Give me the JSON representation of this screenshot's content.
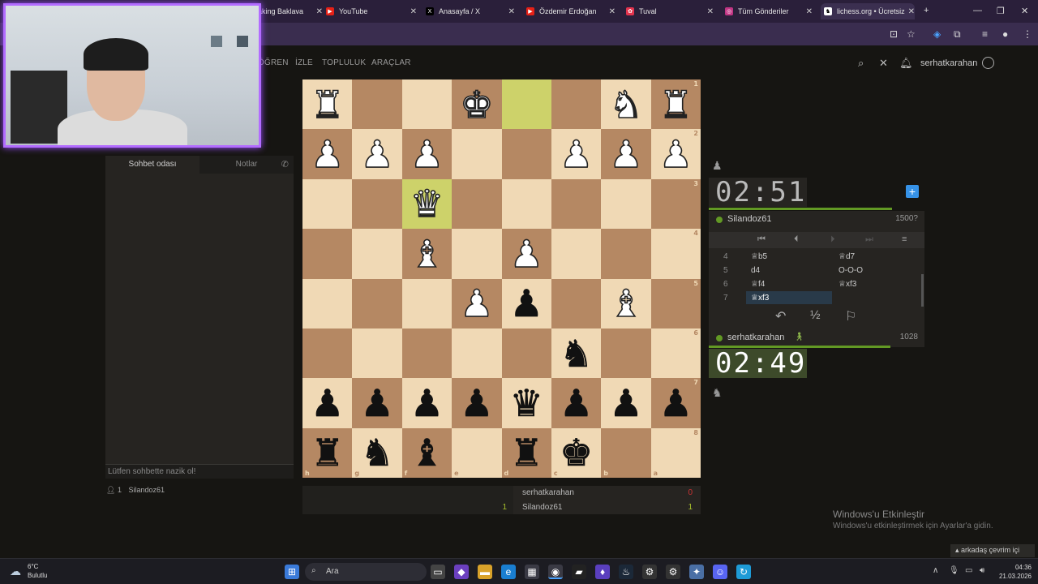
{
  "browser": {
    "tabs": [
      {
        "title": "aking Baklava",
        "color": "#555",
        "glyph": ""
      },
      {
        "title": "YouTube",
        "color": "#e62117",
        "glyph": "▶"
      },
      {
        "title": "Anasayfa / X",
        "color": "#000",
        "glyph": "X"
      },
      {
        "title": "Özdemir Erdoğan",
        "color": "#e62117",
        "glyph": "▶"
      },
      {
        "title": "Tuval",
        "color": "#e3344e",
        "glyph": "✿"
      },
      {
        "title": "Tüm Gönderiler",
        "color": "#c13584",
        "glyph": "◎"
      },
      {
        "title": "lichess.org • Ücretsiz",
        "color": "#fff",
        "glyph": "♞"
      }
    ]
  },
  "nav": {
    "links": [
      "ÖĞREN",
      "İZLE",
      "TOPLULUK",
      "ARAÇLAR"
    ],
    "username": "serhatkarahan"
  },
  "chat": {
    "tab_room": "Sohbet odası",
    "tab_notes": "Notlar",
    "placeholder": "Lütfen sohbette nazik ol!",
    "spectator_count": "1",
    "spectator_name": "Silandoz61"
  },
  "board": {
    "files_bottom": [
      "h",
      "g",
      "f",
      "e",
      "d",
      "c",
      "b",
      "a"
    ],
    "ranks_right": [
      "1",
      "2",
      "3",
      "4",
      "5",
      "6",
      "7",
      "8"
    ],
    "highlight_squares": [
      [
        0,
        4
      ],
      [
        2,
        2
      ]
    ],
    "pieces": [
      [
        "wR",
        "",
        "",
        "wK",
        "",
        "",
        "wN",
        "wR"
      ],
      [
        "wP",
        "wP",
        "wP",
        "",
        "",
        "wP",
        "wP",
        "wP"
      ],
      [
        "",
        "",
        "wQ",
        "",
        "",
        "",
        "",
        ""
      ],
      [
        "",
        "",
        "wB",
        "",
        "wP",
        "",
        "",
        ""
      ],
      [
        "",
        "",
        "",
        "wP",
        "bP",
        "",
        "wB",
        ""
      ],
      [
        "",
        "",
        "",
        "",
        "",
        "bN",
        "",
        ""
      ],
      [
        "bP",
        "bP",
        "bP",
        "bP",
        "bQ",
        "bP",
        "bP",
        "bP"
      ],
      [
        "bR",
        "bN",
        "bB",
        "",
        "bR",
        "bK",
        "",
        ""
      ]
    ]
  },
  "opponent": {
    "name": "Silandoz61",
    "rating": "1500?",
    "clock": "02:51",
    "time_fraction": 0.95
  },
  "player": {
    "name": "serhatkarahan",
    "rating": "1028",
    "clock": "02:49",
    "time_fraction": 0.94
  },
  "moves": [
    {
      "num": "4",
      "white": "♕b5",
      "black": "♕d7"
    },
    {
      "num": "5",
      "white": "d4",
      "black": "O-O-O"
    },
    {
      "num": "6",
      "white": "♕f4",
      "black": "♕xf3"
    },
    {
      "num": "7",
      "white": "♕xf3",
      "black": ""
    }
  ],
  "actions": {
    "draw": "½"
  },
  "crosstable": [
    {
      "name": "serhatkarahan",
      "left_score": "",
      "score": "0",
      "score_color": "#cc3333"
    },
    {
      "name": "Silandoz61",
      "left_score": "1",
      "score": "1",
      "score_color": "#a8c12c"
    }
  ],
  "activation": {
    "title": "Windows'u Etkinleştir",
    "subtitle": "Windows'u etkinleştirmek için Ayarlar'a gidin."
  },
  "friends_label": "arkadaş çevrim içi",
  "taskbar": {
    "temp": "6°C",
    "weather": "Bulutlu",
    "search": "Ara",
    "time": "04:36",
    "date": "21.03.2026"
  }
}
